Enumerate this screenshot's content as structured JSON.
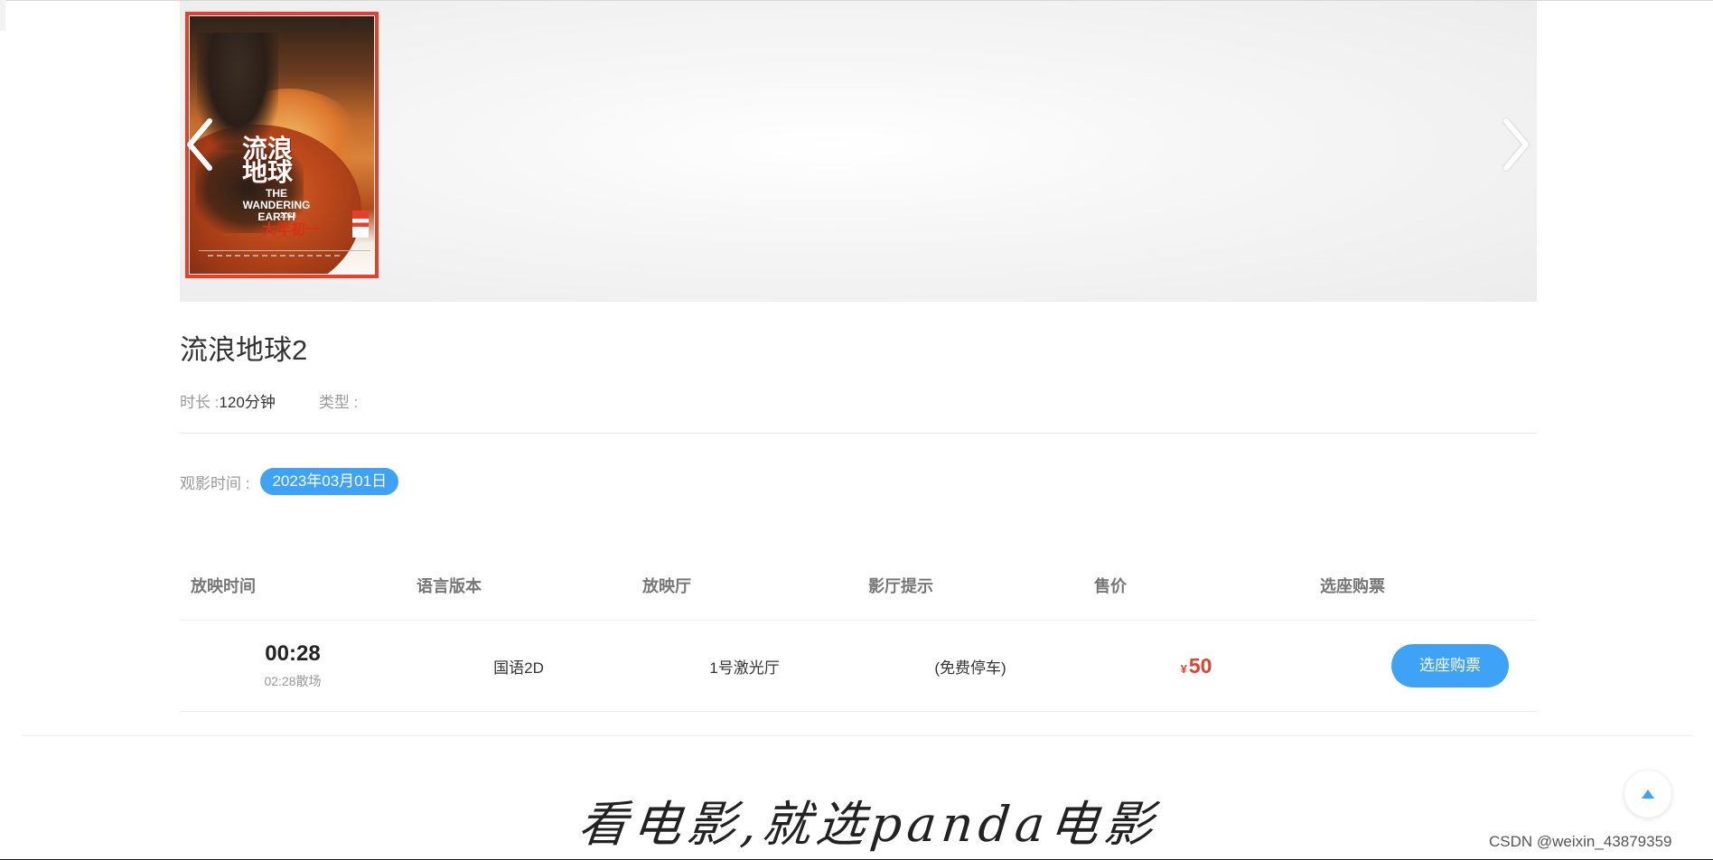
{
  "banner": {
    "poster": {
      "cn_title": "流浪地球",
      "en_title": "THE WANDERING EARTH",
      "year": "2023",
      "tag": "大年初一"
    }
  },
  "movie": {
    "title": "流浪地球2",
    "duration_label": "时长 : ",
    "duration_value": "120分钟",
    "type_label": "类型 :"
  },
  "watch": {
    "label": "观影时间 :",
    "date": "2023年03月01日"
  },
  "table": {
    "headers": [
      "放映时间",
      "语言版本",
      "放映厅",
      "影厅提示",
      "售价",
      "选座购票"
    ],
    "rows": [
      {
        "start": "00:28",
        "end": "02:28散场",
        "language": "国语2D",
        "hall": "1号激光厅",
        "tip": "(免费停车)",
        "currency": "¥",
        "price": "50",
        "action": "选座购票"
      }
    ]
  },
  "footer": {
    "slogan": "看电影,就选panda电影",
    "watermark": "CSDN @weixin_43879359"
  },
  "colors": {
    "accent": "#3ea3f7",
    "price": "#e5402b",
    "poster_border": "#e5402b"
  },
  "icons": {
    "prev": "chevron-left-icon",
    "next": "chevron-right-icon",
    "back_to_top": "caret-up-icon"
  }
}
